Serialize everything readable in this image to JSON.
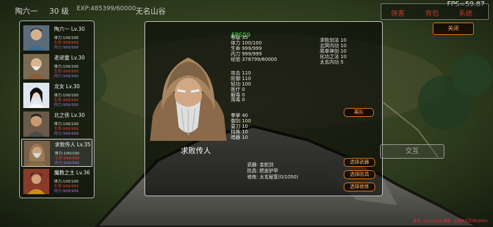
{
  "player": {
    "name": "陶六一",
    "level": "30 级",
    "exp": "EXP:485399/60000",
    "location": "无名山谷"
  },
  "fps_main": "FPS=59.87",
  "fps_small": "FPS59",
  "tabs": [
    "侠客",
    "背包",
    "系统"
  ],
  "close_label": "关闭",
  "interact_label": "交互",
  "party": [
    {
      "name": "陶六一 Lv.30",
      "stats": [
        "体力:100/100",
        "生命:999/999",
        "内力:999/999"
      ],
      "selected": false
    },
    {
      "name": "老顽童 Lv.30",
      "stats": [
        "体力:100/100",
        "生命:999/999",
        "内力:999/999"
      ],
      "selected": false
    },
    {
      "name": "龙女 Lv.30",
      "stats": [
        "体力:100/100",
        "生命:999/999",
        "内力:999/999"
      ],
      "selected": false
    },
    {
      "name": "北之侠 Lv.30",
      "stats": [
        "体力:100/100",
        "生命:999/999",
        "内力:999/999"
      ],
      "selected": false
    },
    {
      "name": "求败传人 Lv.35",
      "stats": [
        "体力:100/100",
        "生命:999/999",
        "内力:999/999"
      ],
      "selected": true
    },
    {
      "name": "魔教之主 Lv.36",
      "stats": [
        "体力:100/100",
        "生命:999/999",
        "内力:999/999"
      ],
      "selected": false
    }
  ],
  "detail": {
    "name": "求败传人",
    "basic": [
      "等级 35",
      "体力 100/100",
      "生命 999/999",
      "内力 999/999",
      "经验 378799/60000"
    ],
    "combat": [
      "攻击 110",
      "防御 110",
      "轻功 100",
      "医疗 0",
      "解毒 0",
      "用毒 0"
    ],
    "skills": [
      "拳掌 40",
      "御剑 100",
      "耍刀 10",
      "特殊 10",
      "暗器 10"
    ],
    "martial": [
      "求败剑法 10",
      "北冥内功 10",
      "简单神剑 10",
      "化功之法 10",
      "太玄内功 5"
    ],
    "equip": [
      "武器: 金蛇剑",
      "防具: 鳄皮护甲",
      "修炼: 太玄秘笈(0/1050)"
    ],
    "buttons": {
      "leave": "离队",
      "weapon": "选择武器",
      "armor": "选择防具",
      "skill": "选择修炼"
    }
  },
  "version": "版本: 20230510 摄炼: 无限肉鸡武侠DEMO"
}
